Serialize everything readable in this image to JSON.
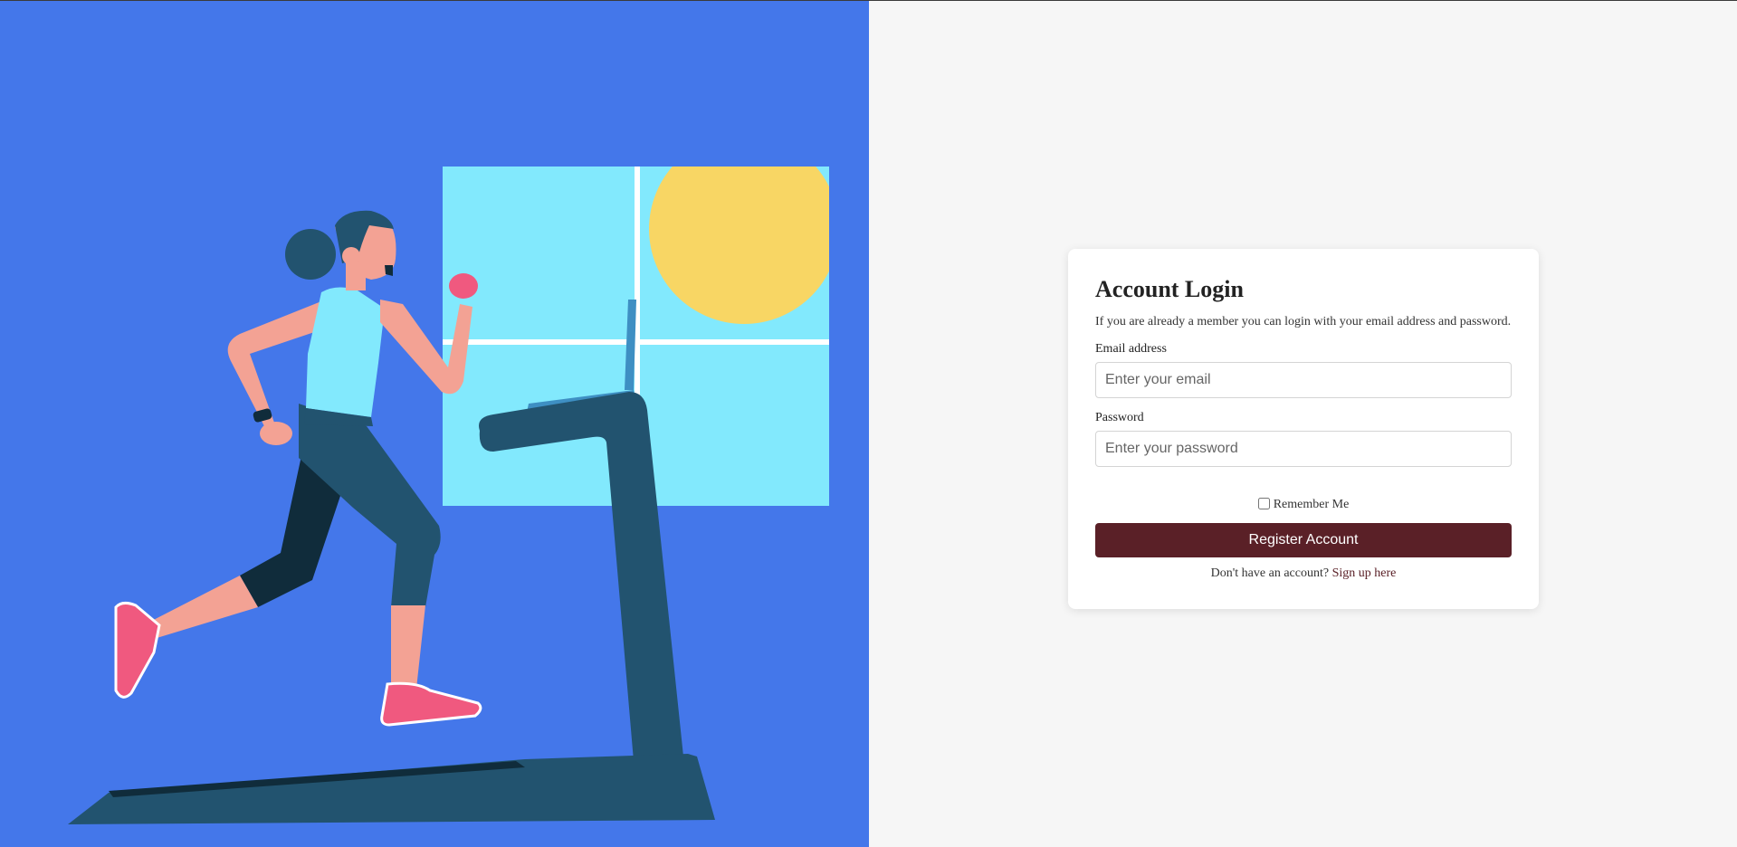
{
  "login": {
    "title": "Account Login",
    "subtitle": "If you are already a member you can login with your email address and password.",
    "email_label": "Email address",
    "email_placeholder": "Enter your email",
    "email_value": "",
    "password_label": "Password",
    "password_placeholder": "Enter your password",
    "password_value": "",
    "remember_label": "Remember Me",
    "remember_checked": false,
    "register_button": "Register Account",
    "signup_prompt": "Don't have an account?",
    "signup_link": "Sign up here"
  },
  "illustration": {
    "icon": "woman-running-on-treadmill-illustration"
  },
  "colors": {
    "left_background": "#4477ea",
    "page_background": "#f6f6f6",
    "accent": "#5a2027",
    "window_glass": "#82e9fd",
    "sun": "#f8d664",
    "treadmill": "#22536f"
  }
}
